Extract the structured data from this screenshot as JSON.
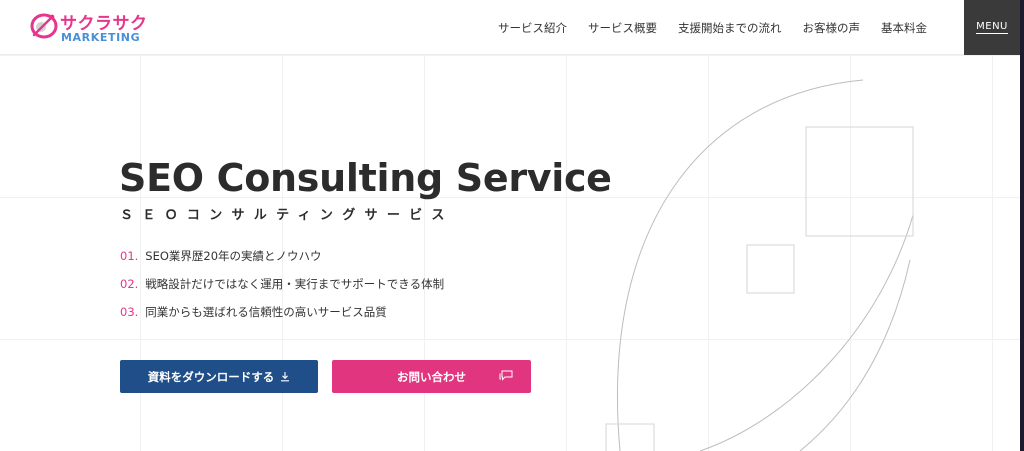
{
  "brand": {
    "name_jp": "サクラサク",
    "name_en": "MARKETING",
    "colors": {
      "pink": "#e6358d",
      "blue": "#4a90d9",
      "navy": "#1f4e88",
      "dark": "#3a3a3a"
    }
  },
  "header": {
    "nav": [
      {
        "label": "サービス紹介"
      },
      {
        "label": "サービス概要"
      },
      {
        "label": "支援開始までの流れ"
      },
      {
        "label": "お客様の声"
      },
      {
        "label": "基本料金"
      }
    ],
    "menu_label": "MENU"
  },
  "hero": {
    "title": "SEO Consulting Service",
    "subtitle": "ＳＥＯコンサルティングサービス",
    "features": [
      {
        "num": "01.",
        "text": "SEO業界歴20年の実績とノウハウ"
      },
      {
        "num": "02.",
        "text": "戦略設計だけではなく運用・実行までサポートできる体制"
      },
      {
        "num": "03.",
        "text": "同業からも選ばれる信頼性の高いサービス品質"
      }
    ],
    "buttons": {
      "download": {
        "label": "資料をダウンロードする",
        "icon": "download-icon"
      },
      "contact": {
        "label": "お問い合わせ",
        "icon": "chat-bubble-icon"
      }
    }
  }
}
